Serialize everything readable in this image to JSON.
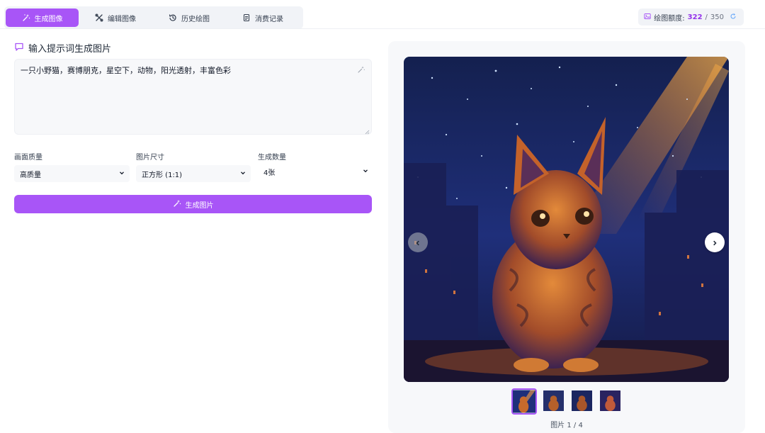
{
  "tabs": [
    {
      "label": "生成图像",
      "icon": "magic-wand-icon",
      "active": true
    },
    {
      "label": "编辑图像",
      "icon": "tools-icon",
      "active": false
    },
    {
      "label": "历史绘图",
      "icon": "history-icon",
      "active": false
    },
    {
      "label": "消费记录",
      "icon": "document-icon",
      "active": false
    }
  ],
  "quota": {
    "label": "绘图额度:",
    "used": "322",
    "separator": " / ",
    "total": "350",
    "icon": "image-icon",
    "refresh_icon": "refresh-icon"
  },
  "prompt": {
    "title": "输入提示词生成图片",
    "value": "一只小野猫，赛博朋克，星空下，动物，阳光透射，丰富色彩"
  },
  "options": {
    "quality": {
      "label": "画面质量",
      "value": "高质量"
    },
    "size": {
      "label": "图片尺寸",
      "value": "正方形 (1:1)"
    },
    "count": {
      "label": "生成数量",
      "value": "4张"
    }
  },
  "generate_button": {
    "label": "生成图片",
    "icon": "magic-wand-icon"
  },
  "gallery": {
    "current": 1,
    "total": 4,
    "counter_text": "图片 1 / 4",
    "colors": {
      "sky": "#1b2a6b",
      "accent": "#a855f7",
      "cat": "#d97a2b"
    }
  }
}
